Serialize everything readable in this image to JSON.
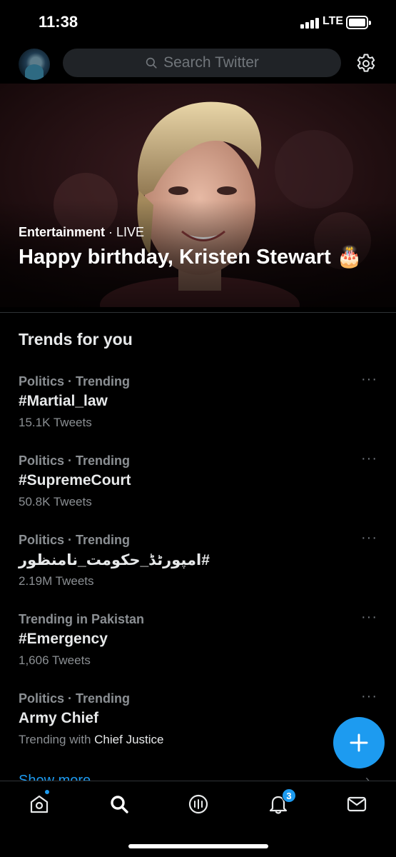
{
  "status_bar": {
    "time": "11:38",
    "network": "LTE"
  },
  "header": {
    "search_placeholder": "Search Twitter"
  },
  "hero": {
    "category": "Entertainment",
    "separator": " · ",
    "status": "LIVE",
    "title": "Happy birthday, Kristen Stewart 🎂"
  },
  "trends": {
    "heading": "Trends for you",
    "items": [
      {
        "context": "Politics · Trending",
        "name": "#Martial_law",
        "count": "15.1K Tweets"
      },
      {
        "context": "Politics · Trending",
        "name": "#SupremeCourt",
        "count": "50.8K Tweets"
      },
      {
        "context": "Politics · Trending",
        "name": "#امپورٹڈ_حکومت_نامنظور",
        "count": "2.19M Tweets"
      },
      {
        "context": "Trending in Pakistan",
        "name": "#Emergency",
        "count": "1,606 Tweets"
      },
      {
        "context": "Politics · Trending",
        "name": "Army Chief",
        "count_prefix": "Trending with ",
        "count_highlight": "Chief Justice"
      }
    ],
    "more_glyph": "···",
    "show_more": "Show more",
    "show_more_chevron": "›"
  },
  "tabbar": {
    "notifications_badge": "3"
  },
  "colors": {
    "accent": "#1d9bf0",
    "background": "#000000",
    "secondary_text": "#71767b"
  }
}
